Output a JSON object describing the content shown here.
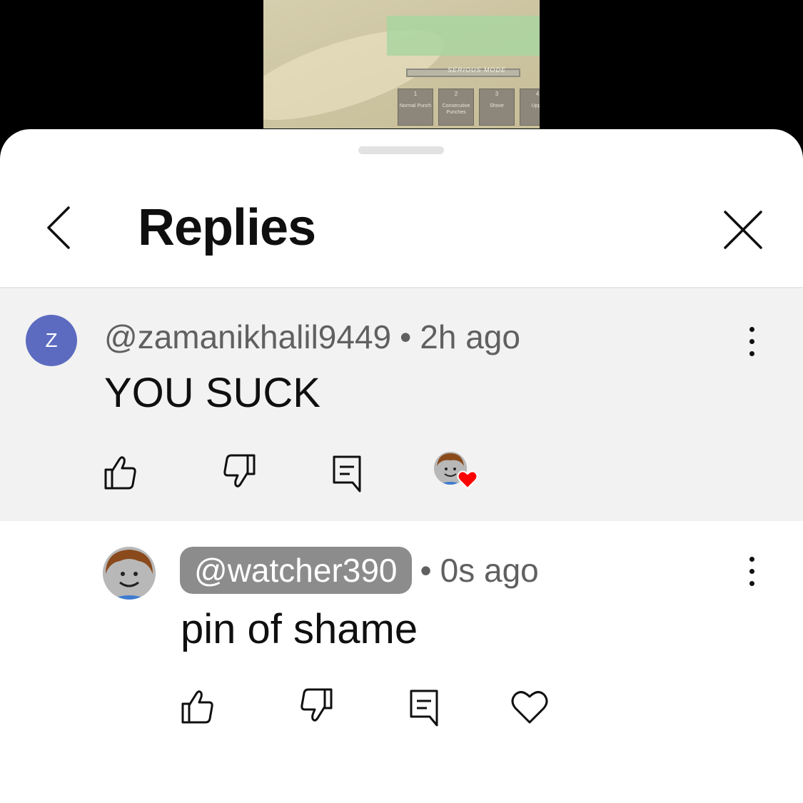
{
  "video": {
    "mode_label": "SERIOUS MODE",
    "slots": [
      {
        "num": "1",
        "label": "Normal Punch"
      },
      {
        "num": "2",
        "label": "Consecutive Punches"
      },
      {
        "num": "3",
        "label": "Shove"
      },
      {
        "num": "4",
        "label": "Uppe"
      }
    ]
  },
  "header": {
    "title": "Replies",
    "back_icon": "chevron-left-icon",
    "close_icon": "close-icon"
  },
  "parent_comment": {
    "avatar_letter": "Z",
    "avatar_color": "#5c6bc0",
    "author": "@zamanikhalil9449",
    "separator": "•",
    "time": "2h ago",
    "text": "YOU SUCK",
    "background": "#f2f2f2"
  },
  "reply_comment": {
    "author": "@watcher390",
    "separator": "•",
    "time": "0s ago",
    "text": "pin of shame",
    "chip_color": "#8c8c8c"
  },
  "colors": {
    "heart": "#ff0000",
    "text_primary": "#0f0f0f",
    "text_secondary": "#606060"
  }
}
